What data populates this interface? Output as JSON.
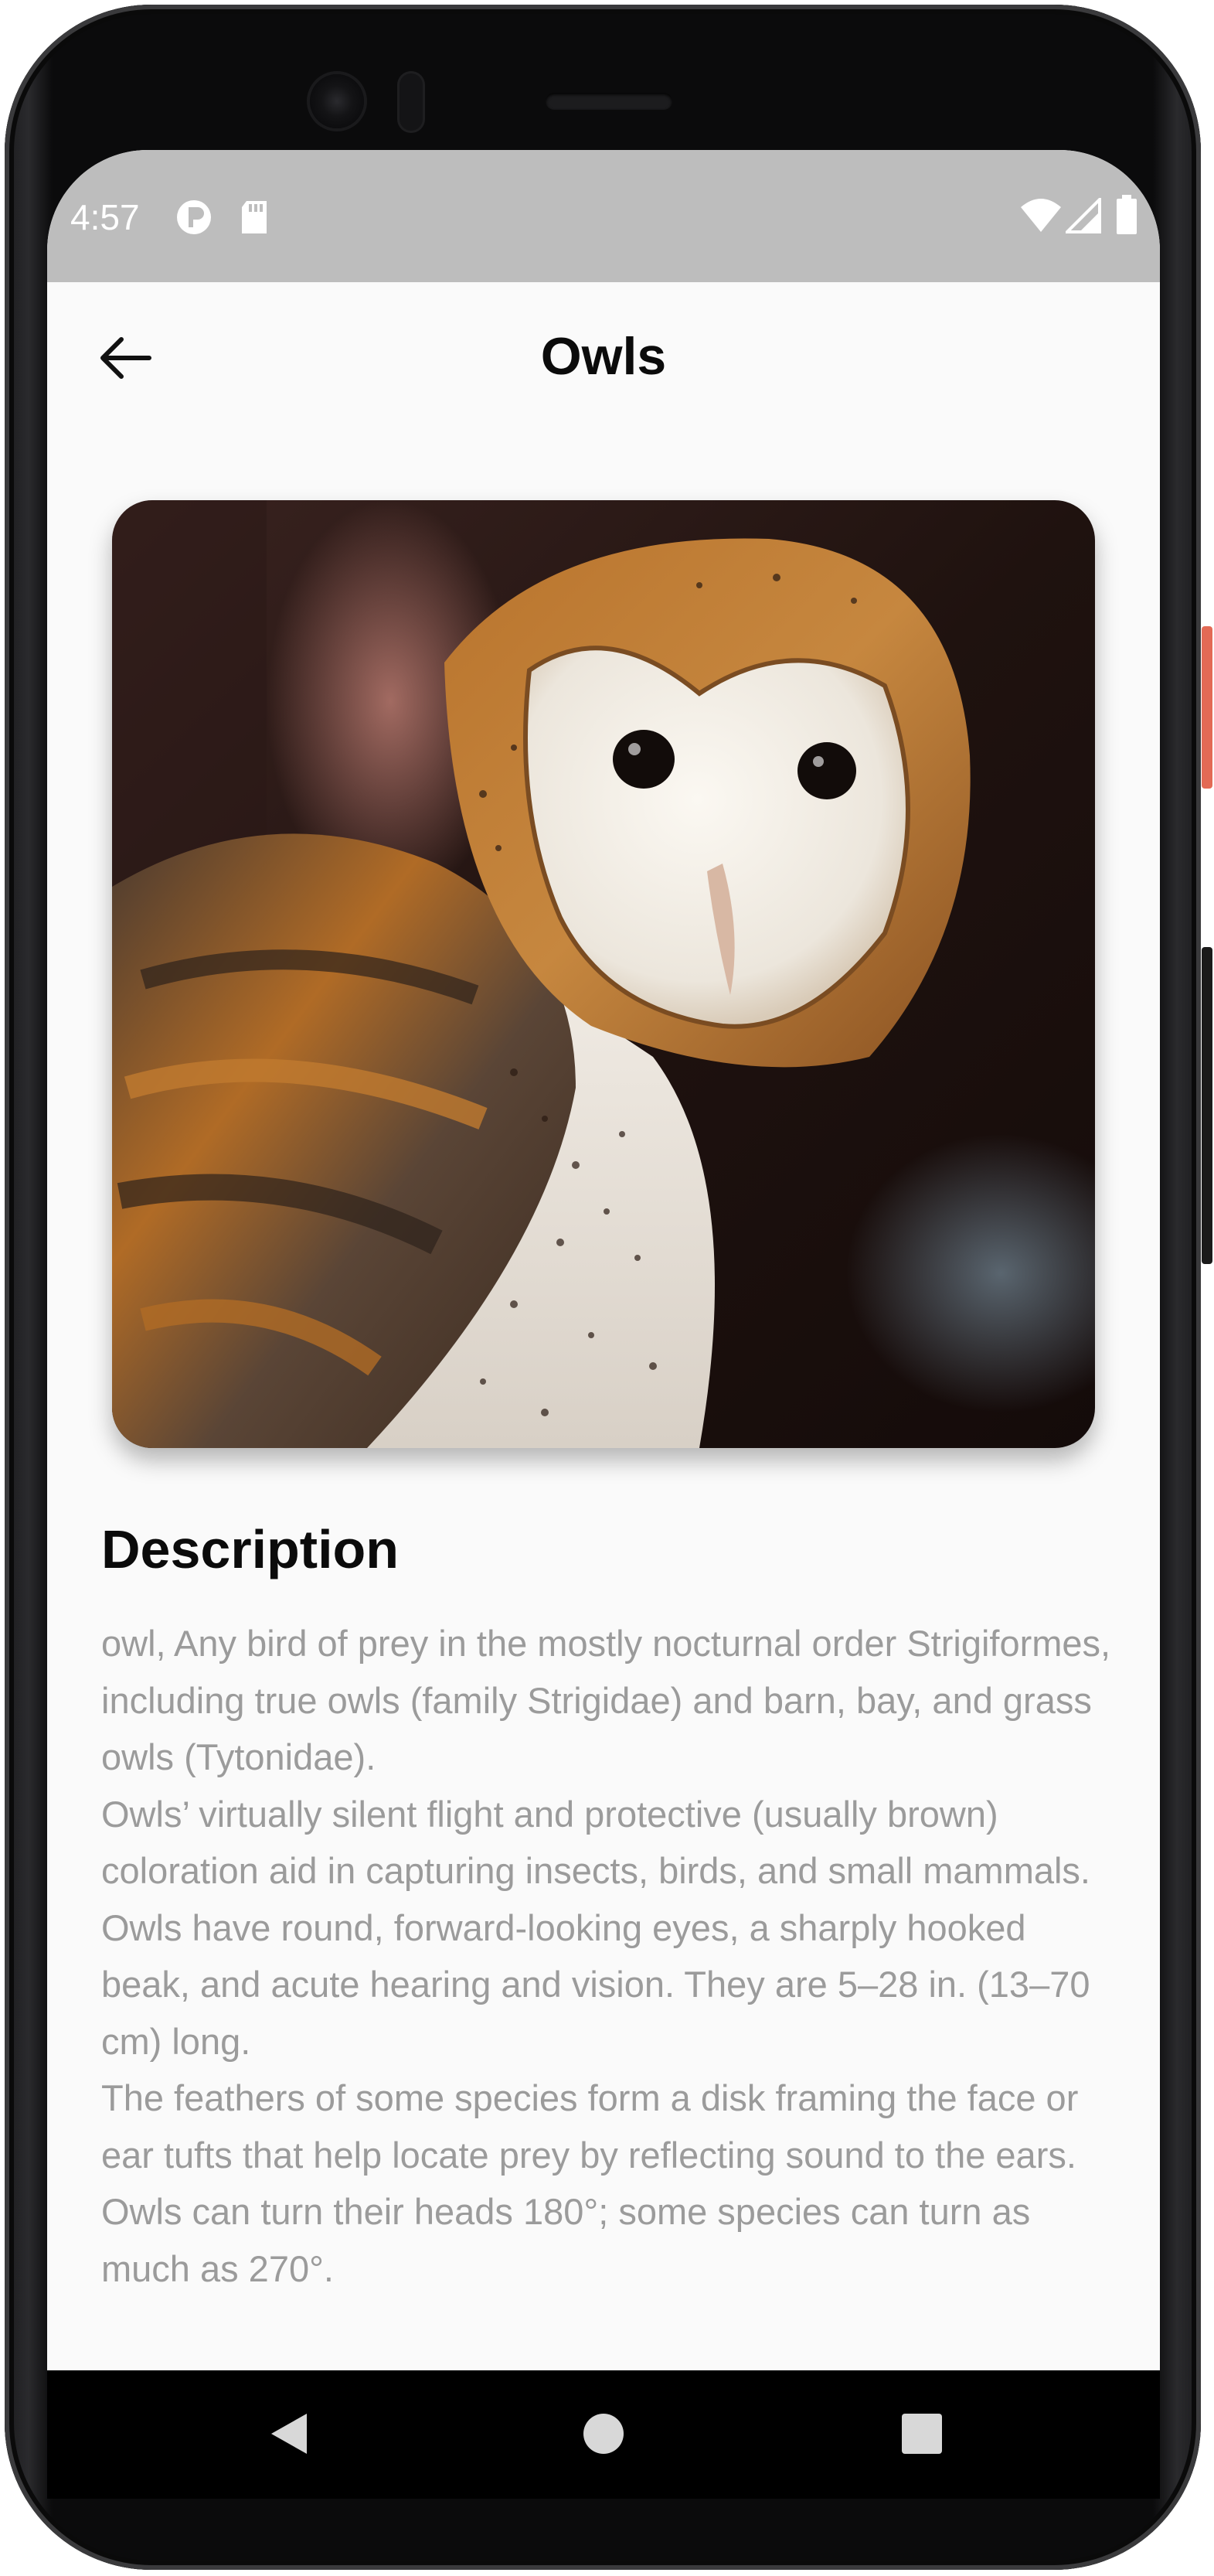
{
  "status_bar": {
    "time": "4:57",
    "left_icons": [
      "p-badge-icon",
      "sd-card-icon"
    ],
    "right_icons": [
      "wifi-icon",
      "signal-icon",
      "battery-icon"
    ]
  },
  "app_bar": {
    "title": "Owls",
    "back_icon": "arrow-left-icon"
  },
  "hero_image": {
    "subject": "barn-owl-photo"
  },
  "description": {
    "heading": "Description",
    "paragraphs": [
      "owl, Any bird of prey in the mostly nocturnal order Strigiformes, including true owls (family Strigidae) and barn, bay, and grass owls (Tytonidae).",
      "Owls’ virtually silent flight and protective (usually brown) coloration aid in capturing insects, birds, and small mammals. Owls have round, forward-looking eyes, a sharply hooked beak, and acute hearing and vision. They are 5–28 in. (13–70 cm) long.",
      "The feathers of some species form a disk framing the face or ear tufts that help locate prey by reflecting sound to the ears. Owls can turn their heads 180°; some species can turn as much as 270°."
    ]
  },
  "nav_bar": {
    "buttons": [
      "back-triangle-icon",
      "home-circle-icon",
      "recents-square-icon"
    ]
  },
  "colors": {
    "status_bar": "#bdbdbd",
    "screen_bg": "#fafafa",
    "title_text": "#0b0b0b",
    "body_text": "#9b9b9b",
    "power_button": "#e36a55"
  }
}
